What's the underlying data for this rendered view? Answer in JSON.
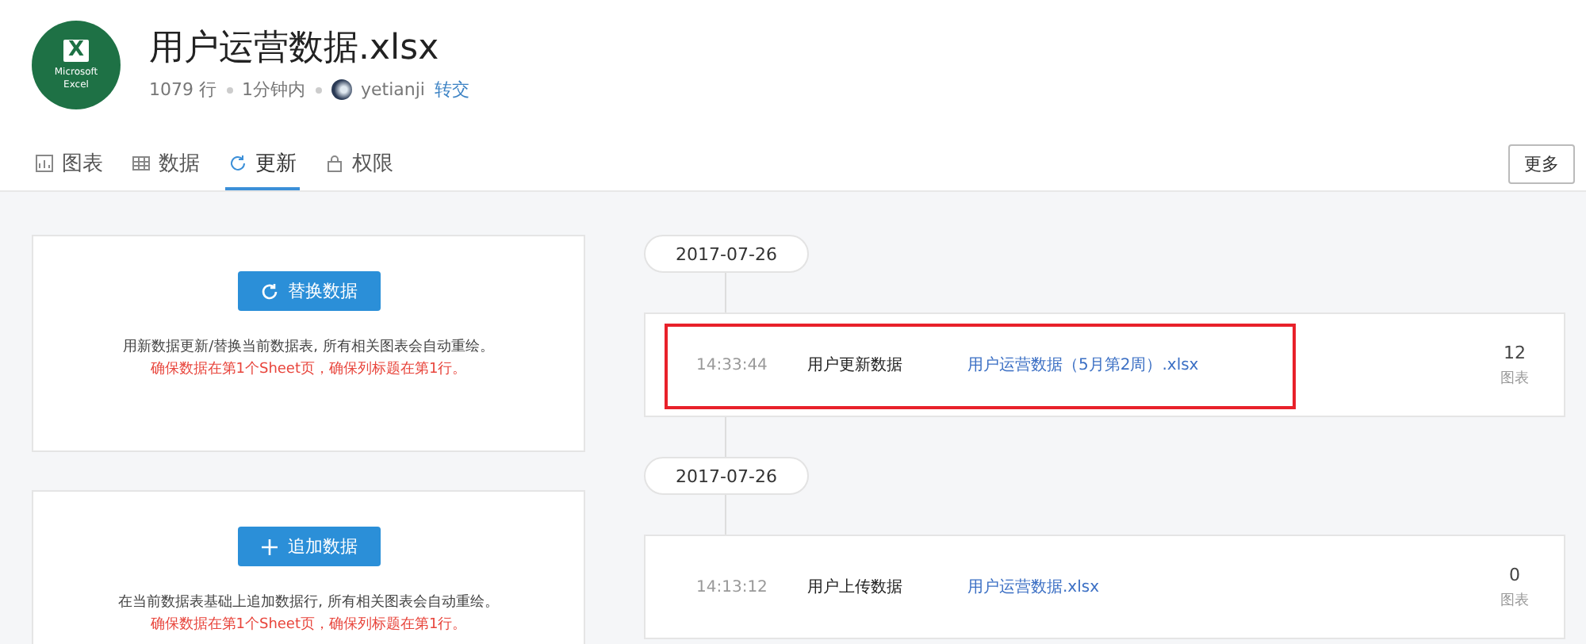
{
  "file": {
    "title": "用户运营数据.xlsx",
    "logo_label": "Microsoft Excel",
    "logo_letter": "X",
    "rows": "1079 行",
    "updated": "1分钟内",
    "owner": "yetianji",
    "transfer_link": "转交"
  },
  "tabs": [
    {
      "label": "图表",
      "kind": "chart",
      "selected": false
    },
    {
      "label": "数据",
      "kind": "table",
      "selected": false
    },
    {
      "label": "更新",
      "kind": "refresh",
      "selected": true
    },
    {
      "label": "权限",
      "kind": "lock",
      "selected": false
    }
  ],
  "more_button": "更多",
  "actions": [
    {
      "kind": "replace",
      "button": "替换数据",
      "description": "用新数据更新/替换当前数据表, 所有相关图表会自动重绘。",
      "warning": "确保数据在第1个Sheet页，确保列标题在第1行。"
    },
    {
      "kind": "append",
      "button": "追加数据",
      "description": "在当前数据表基础上追加数据行, 所有相关图表会自动重绘。",
      "warning": "确保数据在第1个Sheet页，确保列标题在第1行。"
    }
  ],
  "history": [
    {
      "date": "2017-07-26",
      "time": "14:33:44",
      "action": "用户更新数据",
      "file": "用户运营数据（5月第2周）.xlsx",
      "count": "12",
      "count_label": "图表",
      "highlighted": true
    },
    {
      "date": "2017-07-26",
      "time": "14:13:12",
      "action": "用户上传数据",
      "file": "用户运营数据.xlsx",
      "count": "0",
      "count_label": "图表",
      "highlighted": false
    }
  ]
}
